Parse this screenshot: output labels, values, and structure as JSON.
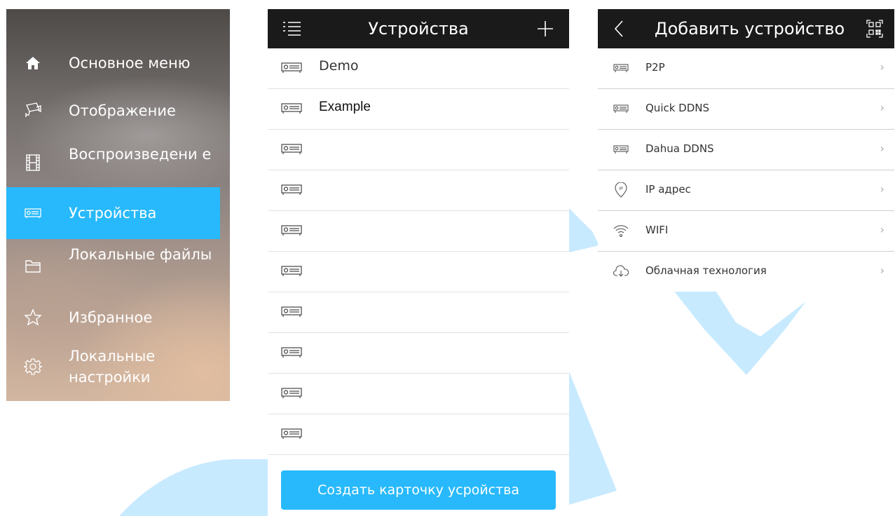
{
  "sidebar": {
    "items": [
      {
        "label": "Основное меню",
        "icon": "home-icon"
      },
      {
        "label": "Отображение",
        "icon": "camera-icon"
      },
      {
        "label": "Воспроизведени е",
        "icon": "film-icon"
      },
      {
        "label": "Устройства",
        "icon": "device-icon",
        "active": true
      },
      {
        "label": "Локальные файлы",
        "icon": "folder-icon"
      },
      {
        "label": "Избранное",
        "icon": "star-icon"
      },
      {
        "label": "Локальные настройки",
        "icon": "gear-icon"
      }
    ]
  },
  "devices": {
    "title": "Устройства",
    "rows": [
      {
        "name": "Demo"
      },
      {
        "name": "Example"
      },
      {
        "name": ""
      },
      {
        "name": ""
      },
      {
        "name": ""
      },
      {
        "name": ""
      },
      {
        "name": ""
      },
      {
        "name": ""
      },
      {
        "name": ""
      },
      {
        "name": ""
      }
    ],
    "create_button": "Создать карточку усройства"
  },
  "add_device": {
    "title": "Добавить устройство",
    "options": [
      {
        "label": "P2P",
        "icon": "device-icon"
      },
      {
        "label": "Quick DDNS",
        "icon": "device-icon"
      },
      {
        "label": "Dahua DDNS",
        "icon": "device-icon"
      },
      {
        "label": "IP адрес",
        "icon": "ip-pin-icon"
      },
      {
        "label": "WIFI",
        "icon": "wifi-icon"
      },
      {
        "label": "Облачная технология",
        "icon": "cloud-icon"
      }
    ]
  },
  "colors": {
    "accent": "#27b9fb",
    "topbar": "#1a1a1a"
  }
}
